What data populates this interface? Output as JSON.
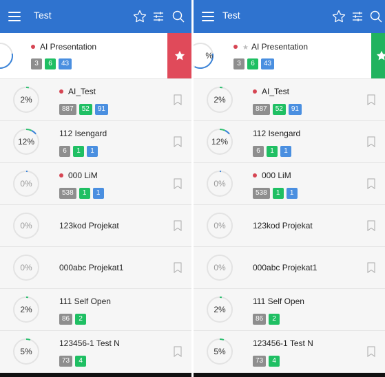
{
  "app": {
    "title": "Test"
  },
  "colors": {
    "appbar": "#2f73cf",
    "ring": "#3a83d8",
    "ring_green": "#2fbf71",
    "dot": "#d64553",
    "fav_red": "#e04a5a",
    "fav_green": "#21b35f"
  },
  "icons": {
    "menu": "menu-icon",
    "favorites": "star-outline-icon",
    "filter": "sliders-icon",
    "search": "search-icon",
    "bookmark": "bookmark-outline-icon",
    "favorite_action": "star-filled-icon"
  },
  "projects": [
    {
      "name": "AI Presentation",
      "dot": true,
      "badges": [
        "3",
        "6",
        "43"
      ]
    },
    {
      "name": "AI_Test",
      "progress": "2%",
      "progress_value": 0.02,
      "dot": true,
      "badges": [
        "887",
        "52",
        "91"
      ]
    },
    {
      "name": "112 Isengard",
      "progress": "12%",
      "progress_value": 0.12,
      "dot": false,
      "badges": [
        "6",
        "1",
        "1"
      ]
    },
    {
      "name": "000 LiM",
      "progress": "0%",
      "progress_value": 0,
      "dot": true,
      "badges": [
        "538",
        "1",
        "1"
      ]
    },
    {
      "name": "123kod Projekat",
      "progress": "0%",
      "progress_value": 0,
      "dot": false,
      "badges": []
    },
    {
      "name": "000abc Projekat1",
      "progress": "0%",
      "progress_value": 0,
      "dot": false,
      "badges": []
    },
    {
      "name": "111 Self Open",
      "progress": "2%",
      "progress_value": 0.02,
      "dot": false,
      "badges": [
        "86",
        "2"
      ]
    },
    {
      "name": "123456-1 Test N",
      "progress": "5%",
      "progress_value": 0.05,
      "dot": false,
      "badges": [
        "73",
        "4"
      ]
    }
  ],
  "left_first_ring_label": "",
  "right_first_ring_label": "%"
}
